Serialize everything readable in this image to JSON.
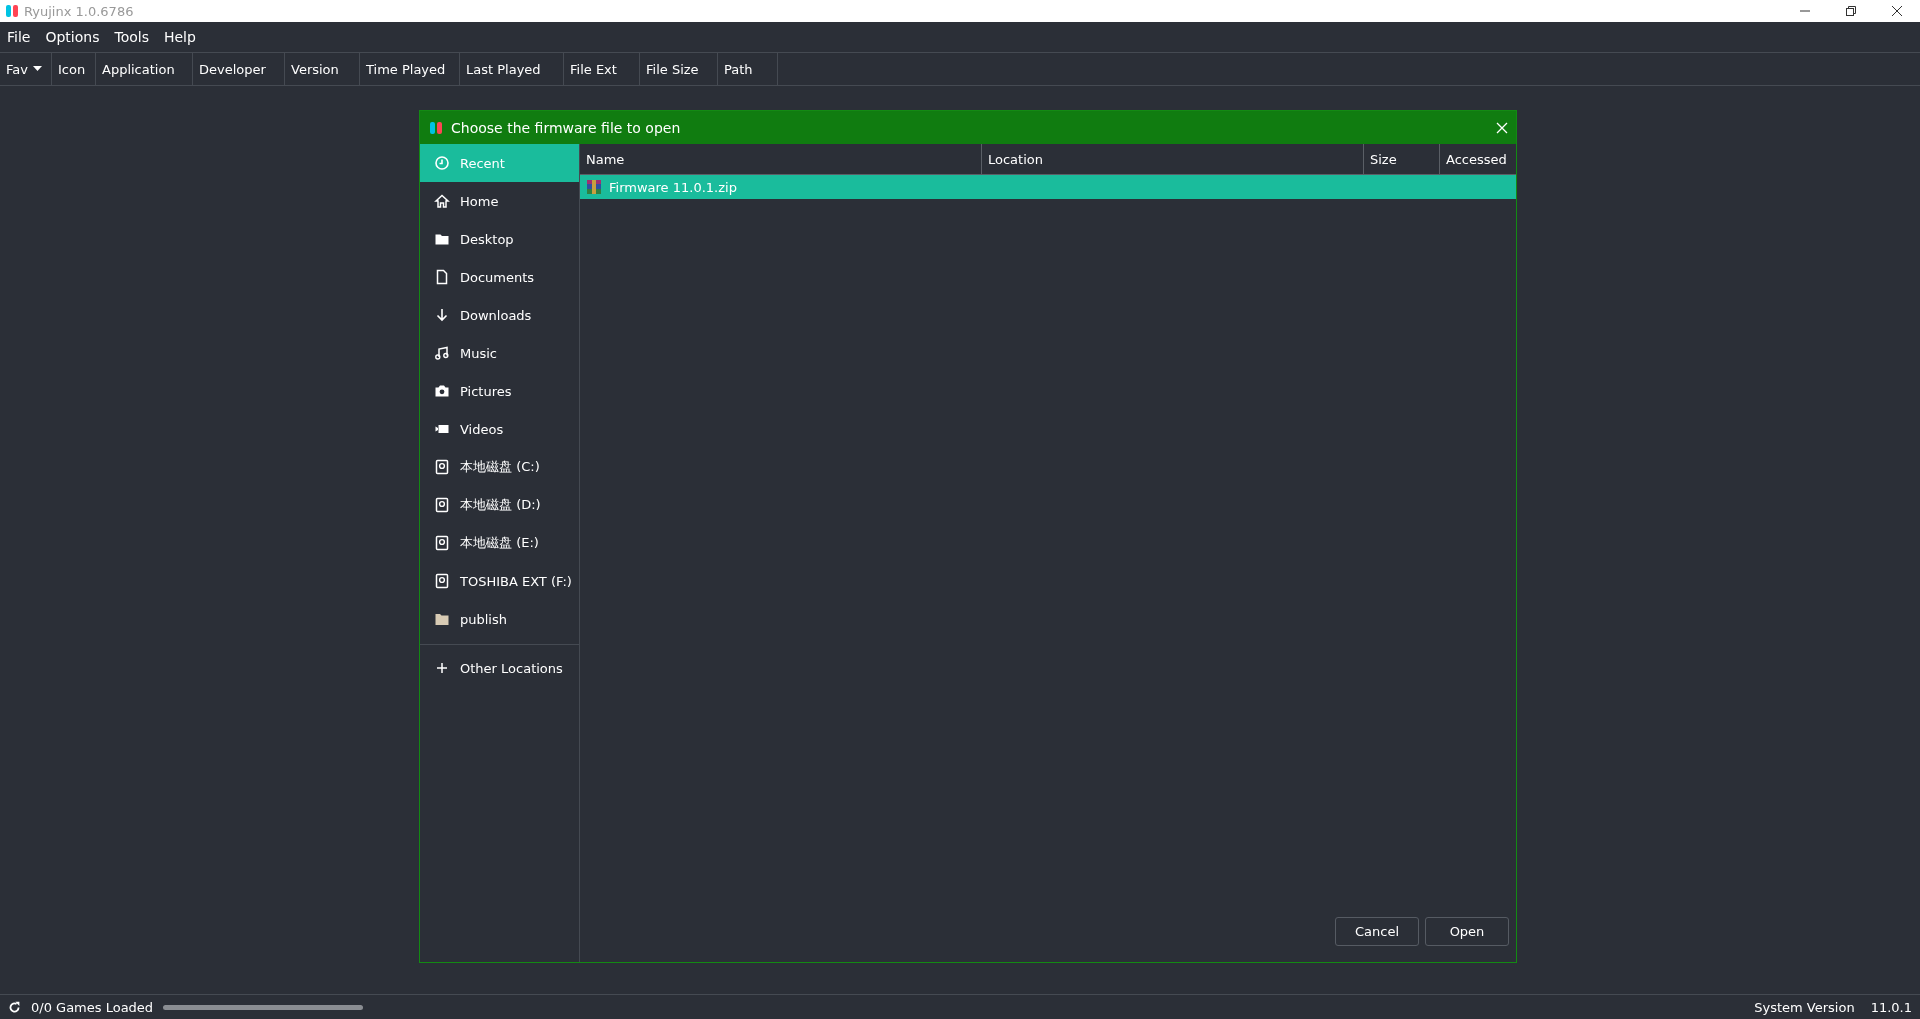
{
  "window": {
    "title": "Ryujinx 1.0.6786"
  },
  "menu": [
    "File",
    "Options",
    "Tools",
    "Help"
  ],
  "game_list": {
    "columns": [
      {
        "label": "Fav",
        "sortable": true
      },
      {
        "label": "Icon",
        "sortable": false
      },
      {
        "label": "Application",
        "sortable": false
      },
      {
        "label": "Developer",
        "sortable": false
      },
      {
        "label": "Version",
        "sortable": false
      },
      {
        "label": "Time Played",
        "sortable": false
      },
      {
        "label": "Last Played",
        "sortable": false
      },
      {
        "label": "File Ext",
        "sortable": false
      },
      {
        "label": "File Size",
        "sortable": false
      },
      {
        "label": "Path",
        "sortable": false
      }
    ]
  },
  "dialog": {
    "title": "Choose the firmware file to open",
    "places": [
      {
        "label": "Recent",
        "kind": "recent",
        "selected": true
      },
      {
        "label": "Home",
        "kind": "home",
        "selected": false
      },
      {
        "label": "Desktop",
        "kind": "desktop",
        "selected": false
      },
      {
        "label": "Documents",
        "kind": "documents",
        "selected": false
      },
      {
        "label": "Downloads",
        "kind": "downloads",
        "selected": false
      },
      {
        "label": "Music",
        "kind": "music",
        "selected": false
      },
      {
        "label": "Pictures",
        "kind": "pictures",
        "selected": false
      },
      {
        "label": "Videos",
        "kind": "videos",
        "selected": false
      },
      {
        "label": "本地磁盘 (C:)",
        "kind": "drive",
        "selected": false
      },
      {
        "label": "本地磁盘 (D:)",
        "kind": "drive",
        "selected": false
      },
      {
        "label": "本地磁盘 (E:)",
        "kind": "drive",
        "selected": false
      },
      {
        "label": "TOSHIBA EXT (F:)",
        "kind": "drive",
        "selected": false
      },
      {
        "label": "publish",
        "kind": "folder",
        "selected": false
      }
    ],
    "other_locations": "Other Locations",
    "columns": [
      "Name",
      "Location",
      "Size",
      "Accessed"
    ],
    "files": [
      {
        "name": "Firmware 11.0.1.zip",
        "selected": true
      }
    ],
    "buttons": [
      "Cancel",
      "Open"
    ]
  },
  "status_bar": {
    "games_loaded": "0/0 Games Loaded",
    "progress": {
      "level": 0
    },
    "system_version_label": "System Version",
    "system_version": "11.0.1"
  }
}
